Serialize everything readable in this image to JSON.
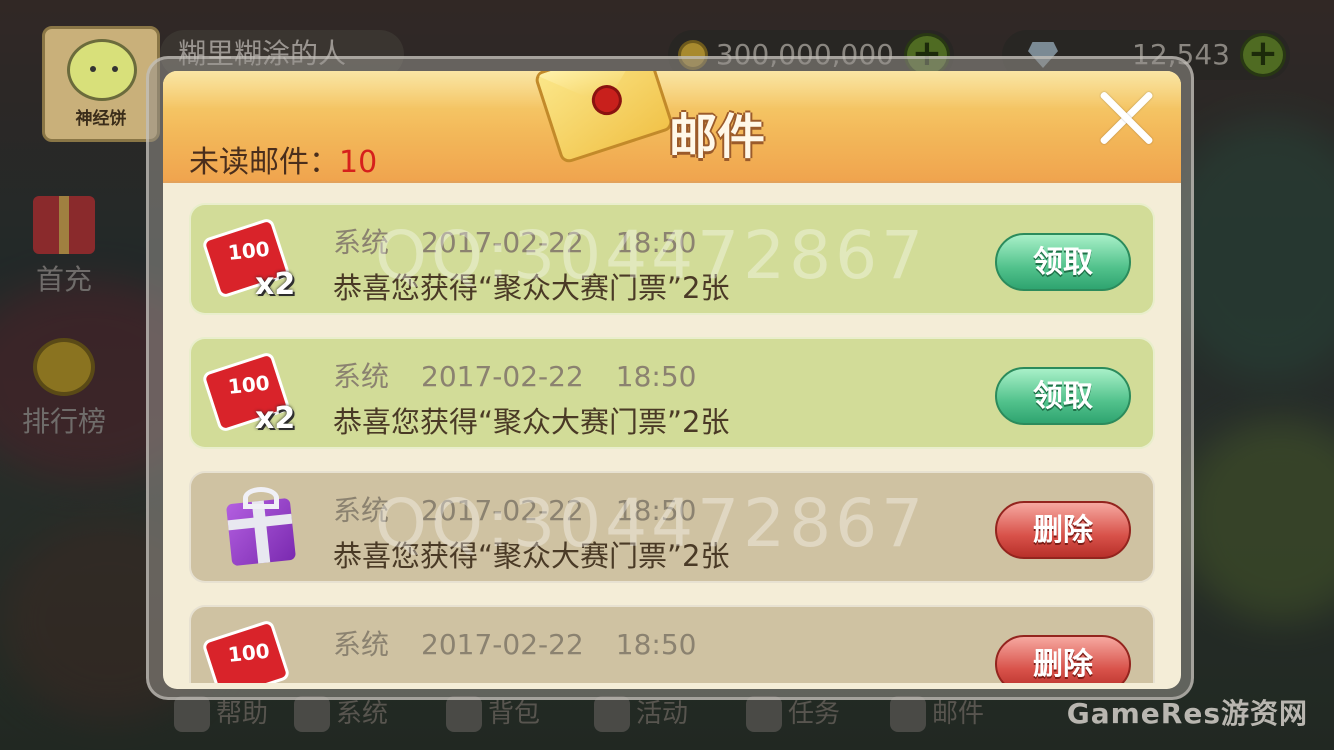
{
  "player": {
    "avatar_tag": "神经饼",
    "name": "糊里糊涂的人"
  },
  "resources": {
    "gold": "300,000,000",
    "diamonds": "12,543"
  },
  "side_buttons": [
    {
      "label": "首充",
      "icon": "gift-icon"
    },
    {
      "label": "排行榜",
      "icon": "medal-icon"
    }
  ],
  "bottom_bar": [
    {
      "label": "帮助",
      "icon": "help-icon"
    },
    {
      "label": "系统",
      "icon": "gear-icon"
    },
    {
      "label": "背包",
      "icon": "bag-icon"
    },
    {
      "label": "活动",
      "icon": "activity-icon"
    },
    {
      "label": "任务",
      "icon": "task-icon"
    },
    {
      "label": "邮件",
      "icon": "mail-icon"
    }
  ],
  "corner_watermark": "GameRes游资网",
  "mail_dialog": {
    "title": "邮件",
    "unread_label": "未读邮件：",
    "unread_count": "10",
    "watermark": "QQ:304472867",
    "mails": [
      {
        "sender": "系统",
        "date": "2017-02-22",
        "time": "18:50",
        "content": "恭喜您获得“聚众大赛门票”2张",
        "icon": "ticket-icon",
        "icon_badge": "100",
        "icon_multiplier": "x2",
        "action": "领取",
        "state": "unclaimed"
      },
      {
        "sender": "系统",
        "date": "2017-02-22",
        "time": "18:50",
        "content": "恭喜您获得“聚众大赛门票”2张",
        "icon": "ticket-icon",
        "icon_badge": "100",
        "icon_multiplier": "x2",
        "action": "领取",
        "state": "unclaimed"
      },
      {
        "sender": "系统",
        "date": "2017-02-22",
        "time": "18:50",
        "content": "恭喜您获得“聚众大赛门票”2张",
        "icon": "gift-box-icon",
        "action": "删除",
        "state": "claimed"
      },
      {
        "sender": "系统",
        "date": "2017-02-22",
        "time": "18:50",
        "content": "",
        "icon": "ticket-icon",
        "icon_badge": "100",
        "action": "删除",
        "state": "claimed"
      }
    ]
  },
  "colors": {
    "unread_count": "#d6201c",
    "claim_button": "#52c28c",
    "delete_button": "#d8524a",
    "header_gold": "#f3b95a"
  }
}
